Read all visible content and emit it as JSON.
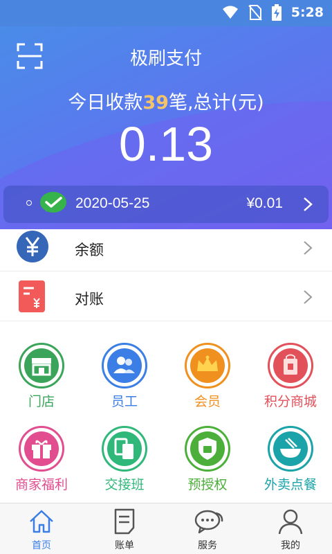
{
  "status_bar": {
    "time": "5:28"
  },
  "header": {
    "title": "极刷支付",
    "summary_prefix": "今日收款",
    "summary_count": "39",
    "summary_suffix": "笔,总计(元)",
    "total_amount": "0.13"
  },
  "latest_transaction": {
    "date": "2020-05-25",
    "amount": "¥0.01",
    "channel_icon": "wechat-pay-icon"
  },
  "menu": [
    {
      "label": "余额",
      "icon": "yuan-icon"
    },
    {
      "label": "对账",
      "icon": "bill-icon"
    }
  ],
  "features": [
    {
      "label": "门店",
      "icon": "store-icon",
      "color": "#3aa55a"
    },
    {
      "label": "员工",
      "icon": "staff-icon",
      "color": "#3a7ee6"
    },
    {
      "label": "会员",
      "icon": "crown-icon",
      "color": "#f0901e"
    },
    {
      "label": "积分商城",
      "icon": "gift-bag-icon",
      "color": "#e2505a"
    },
    {
      "label": "商家福利",
      "icon": "gift-box-icon",
      "color": "#e24d8f"
    },
    {
      "label": "交接班",
      "icon": "handover-icon",
      "color": "#2fb87a"
    },
    {
      "label": "预授权",
      "icon": "auth-shield-icon",
      "color": "#4caf3a"
    },
    {
      "label": "外卖点餐",
      "icon": "food-bowl-icon",
      "color": "#1aa3a8"
    }
  ],
  "tabs": [
    {
      "label": "首页",
      "icon": "home-icon",
      "active": true
    },
    {
      "label": "账单",
      "icon": "bill-doc-icon",
      "active": false
    },
    {
      "label": "服务",
      "icon": "chat-icon",
      "active": false
    },
    {
      "label": "我的",
      "icon": "user-icon",
      "active": false
    }
  ],
  "colors": {
    "accent": "#3a7ee6",
    "count_highlight": "#f4c46a",
    "header_start": "#4a8ce8",
    "header_end": "#6e66f0"
  }
}
